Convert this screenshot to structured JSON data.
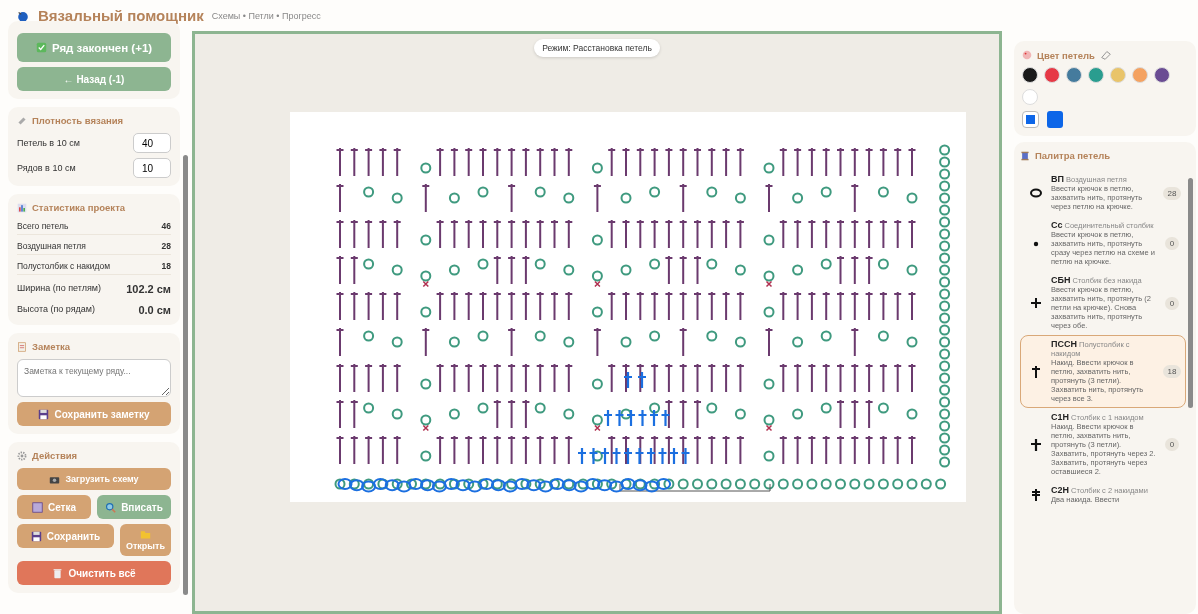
{
  "header": {
    "title": "Вязальный помощник",
    "nav": "Схемы • Петли • Прогресс"
  },
  "progress": {
    "done_button": "Ряд закончен (+1)",
    "back_button": "← Назад (-1)"
  },
  "density": {
    "title": "Плотность вязания",
    "fields": [
      {
        "label": "Петель в 10 см",
        "value": "40"
      },
      {
        "label": "Рядов в 10 см",
        "value": "10"
      }
    ]
  },
  "stats": {
    "title": "Статистика проекта",
    "rows": [
      {
        "label": "Всего петель",
        "value": "46",
        "kind": "count"
      },
      {
        "label": "Воздушная петля",
        "value": "28",
        "kind": "count"
      },
      {
        "label": "Полустолбик с накидом",
        "value": "18",
        "kind": "count"
      },
      {
        "label": "Ширина (по петлям)",
        "value": "102.2 см",
        "kind": "total"
      },
      {
        "label": "Высота (по рядам)",
        "value": "0.0 см",
        "kind": "total"
      }
    ]
  },
  "note": {
    "title": "Заметка",
    "placeholder": "Заметка к текущему ряду...",
    "save_button": "Сохранить заметку"
  },
  "actions": {
    "title": "Действия",
    "load": "Загрузить схему",
    "grid": "Сетка",
    "fit": "Вписать",
    "save": "Сохранить",
    "open": "Открыть",
    "clear": "Очистить всё"
  },
  "canvas": {
    "mode": "Режим: Расстановка петель"
  },
  "colors": {
    "title": "Цвет петель",
    "swatches": [
      {
        "color": "#1a1a1a",
        "selected": false
      },
      {
        "color": "#e63946",
        "selected": false
      },
      {
        "color": "#457b9d",
        "selected": false
      },
      {
        "color": "#2a9d8f",
        "selected": false
      },
      {
        "color": "#e9c46a",
        "selected": false
      },
      {
        "color": "#f4a261",
        "selected": false
      },
      {
        "color": "#6a4c93",
        "selected": false
      },
      {
        "color": "#ffffff",
        "selected": false
      }
    ],
    "picker": {
      "color": "#0d66e8"
    },
    "current": {
      "color": "#0d66e8"
    }
  },
  "palette": {
    "title": "Палитра петель",
    "stitches": [
      {
        "kind": "chain",
        "abbr": "ВП",
        "name": "Воздушная петля",
        "description": "Ввести крючок в петлю, захватить нить, протянуть через петлю на крючке.",
        "count": "28",
        "selected": false
      },
      {
        "kind": "slip",
        "abbr": "Сс",
        "name": "Соединительный столбик",
        "description": "Ввести крючок в петлю, захватить нить, протянуть сразу через петлю на схеме и петлю на крючке.",
        "count": "0",
        "selected": false
      },
      {
        "kind": "sc",
        "abbr": "СБН",
        "name": "Столбик без накида",
        "description": "Ввести крючок в петлю, захватить нить, протянуть (2 петли на крючке). Снова захватить нить, протянуть через обе.",
        "count": "0",
        "selected": false
      },
      {
        "kind": "hdc",
        "abbr": "ПССН",
        "name": "Полустолбик с накидом",
        "description": "Накид. Ввести крючок в петлю, захватить нить, протянуть (3 петли). Захватить нить, протянуть через все 3.",
        "count": "18",
        "selected": true
      },
      {
        "kind": "dc",
        "abbr": "С1Н",
        "name": "Столбик с 1 накидом",
        "description": "Накид. Ввести крючок в петлю, захватить нить, протянуть (3 петли). Захватить, протянуть через 2. Захватить, протянуть через оставшиеся 2.",
        "count": "0",
        "selected": false
      },
      {
        "kind": "tr",
        "abbr": "С2Н",
        "name": "Столбик с 2 накидами",
        "description": "Два накида. Ввести",
        "selected": false
      }
    ]
  }
}
